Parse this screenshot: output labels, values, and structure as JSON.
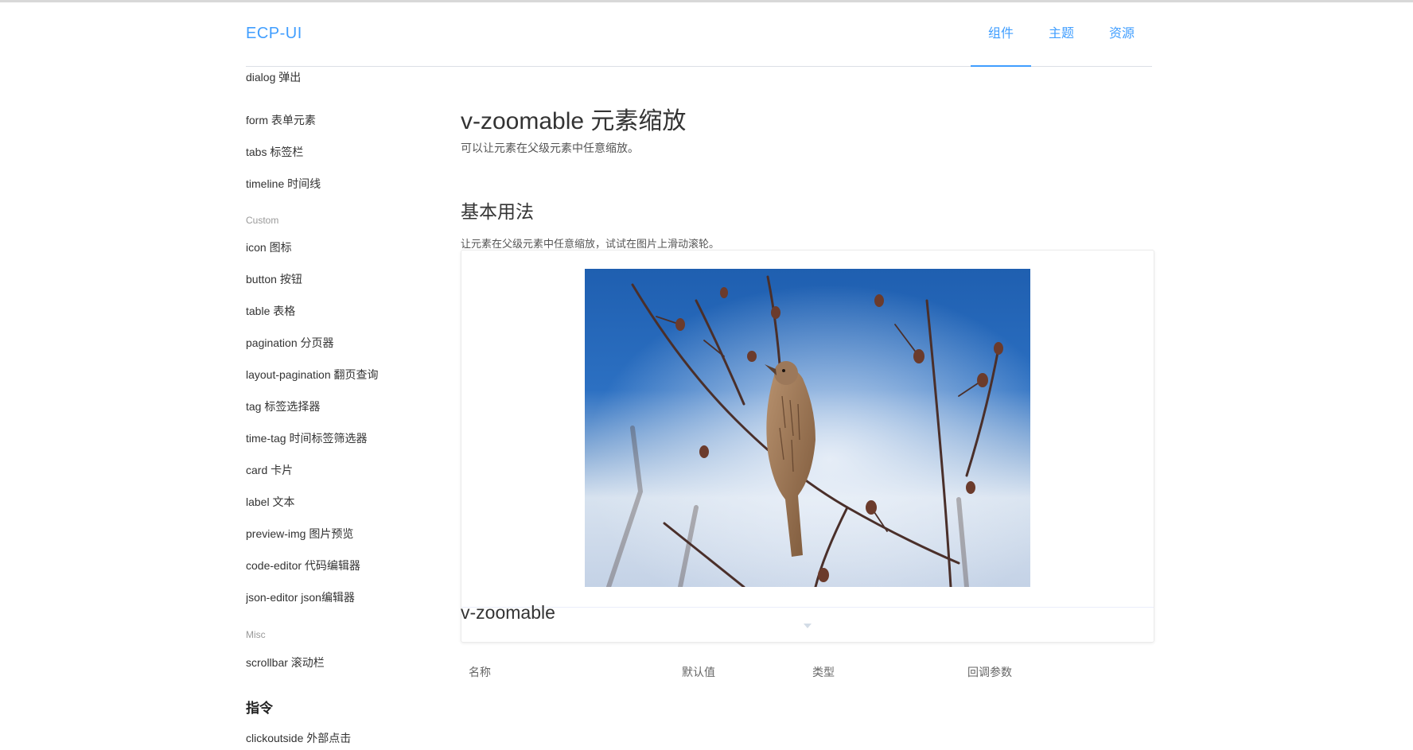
{
  "header": {
    "logo": "ECP-UI",
    "nav": [
      "组件",
      "主题",
      "资源"
    ],
    "active_nav": "组件"
  },
  "sidebar": {
    "cut_off_item": "dialog 弹出",
    "items_a": [
      "form 表单元素",
      "tabs 标签栏",
      "timeline 时间线"
    ],
    "group_custom": "Custom",
    "items_custom": [
      "icon 图标",
      "button 按钮",
      "table 表格",
      "pagination 分页器",
      "layout-pagination 翻页查询",
      "tag 标签选择器",
      "time-tag 时间标签筛选器",
      "card 卡片",
      "label 文本",
      "preview-img 图片预览",
      "code-editor 代码编辑器",
      "json-editor json编辑器"
    ],
    "group_misc": "Misc",
    "items_misc": [
      "scrollbar 滚动栏"
    ],
    "heading_directive": "指令",
    "items_directive": [
      "clickoutside 外部点击"
    ]
  },
  "main": {
    "title": "v-zoomable 元素缩放",
    "description": "可以让元素在父级元素中任意缩放。",
    "section_basic": "基本用法",
    "section_basic_desc": "让元素在父级元素中任意缩放，试试在图片上滑动滚轮。",
    "section_api": "v-zoomable",
    "table_headers": [
      "名称",
      "默认值",
      "类型",
      "回调参数"
    ]
  },
  "colors": {
    "accent": "#409eff",
    "text": "#333333",
    "muted": "#999999",
    "border": "#dcdfe6"
  },
  "icons": {
    "expand": "caret-down-icon"
  }
}
